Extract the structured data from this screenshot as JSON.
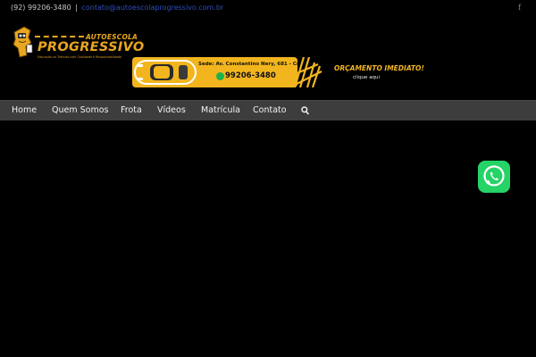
{
  "topbar": {
    "phone": "(92) 99206-3480",
    "separator": "|",
    "email": "contato@autoescolaprogressivo.com.br",
    "facebook_glyph": "f"
  },
  "logo": {
    "brand_top": "AUTOESCOLA",
    "brand_main": "PROGRESSIVO",
    "tagline": "Educação no Trânsito com Qualidade e Responsabilidade",
    "icon": "mascot-icon",
    "colors": {
      "brand": "#e9a61f"
    }
  },
  "banner": {
    "address": "Sede: Av. Constantino Nery, 681 - Centro",
    "phone": "99206-3480",
    "cta": "ORÇAMENTO IMEDIATO!",
    "cta_sub": "clique aqui",
    "colors": {
      "accent": "#f2b51e"
    }
  },
  "nav": {
    "items": [
      {
        "label": "Home"
      },
      {
        "label": "Quem Somos"
      },
      {
        "label": "Frota"
      },
      {
        "label": "Vídeos"
      },
      {
        "label": "Matrícula"
      },
      {
        "label": "Contato"
      }
    ],
    "search_icon": "search-icon",
    "colors": {
      "bar": "#3d3d3d",
      "text": "#f1f1f1"
    }
  },
  "floating": {
    "whatsapp_icon": "whatsapp-icon",
    "color": "#25d366"
  }
}
